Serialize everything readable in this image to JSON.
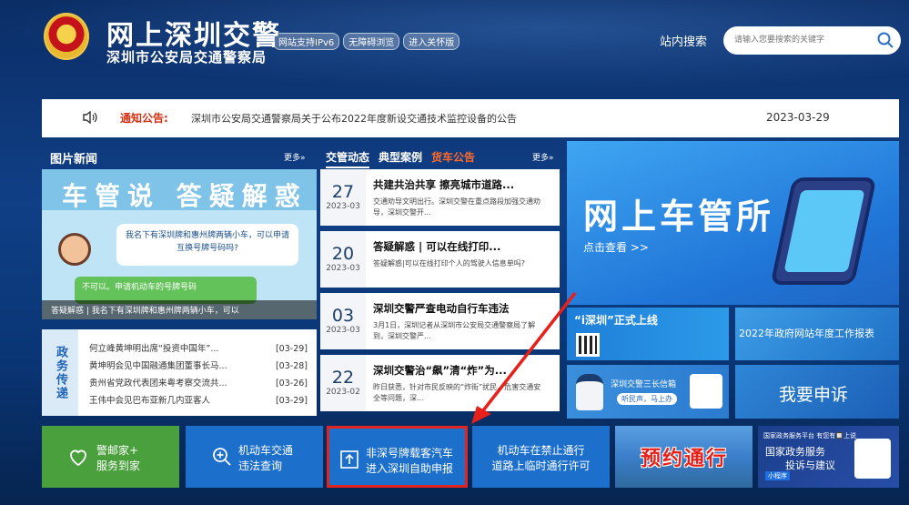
{
  "header": {
    "title": "网上深圳交警",
    "subtitle": "深圳市公安局交通警察局",
    "badges": [
      "网站支持IPv6",
      "无障碍浏览",
      "进入关怀版"
    ],
    "search_label": "站内搜索",
    "search_placeholder": "请输入您要搜索的关键字"
  },
  "notice": {
    "label": "通知公告:",
    "text": "深圳市公安局交通警察局关于公布2022年度新设交通技术监控设备的公告",
    "date": "2023-03-29"
  },
  "photo_news": {
    "title": "图片新闻",
    "more": "更多»",
    "image_heading": "车管说 答疑解惑",
    "bubble_question": "我名下有深圳牌和惠州牌两辆小车，可以申请互换号牌号码吗?",
    "bubble_answer": "不可以。申请机动车的号牌号码",
    "caption": "答疑解惑 | 我名下有深圳牌和惠州牌两辆小车，可以"
  },
  "gov_affairs": {
    "side_label": "政务传递",
    "items": [
      {
        "text": "何立峰黄坤明出席“投资中国年”...",
        "date": "[03-29]"
      },
      {
        "text": "黄坤明会见中国融通集团董事长马...",
        "date": "[03-28]"
      },
      {
        "text": "贵州省党政代表团来粤考察交流共...",
        "date": "[03-26]"
      },
      {
        "text": "王伟中会见巴布亚新几内亚客人",
        "date": "[03-29]"
      }
    ]
  },
  "news": {
    "tabs": [
      "交管动态",
      "典型案例",
      "货车公告"
    ],
    "more": "更多»",
    "items": [
      {
        "day": "27",
        "ym": "2023-03",
        "title": "共建共治共享 擦亮城市道路...",
        "desc": "交通劝导文明出行。深圳交警在重点路段加强交通劝导，深圳交警开..."
      },
      {
        "day": "20",
        "ym": "2023-03",
        "title": "答疑解惑 | 可以在线打印...",
        "desc": "答疑解惑|可以在线打印个人的驾驶人信息单吗?"
      },
      {
        "day": "03",
        "ym": "2023-03",
        "title": "深圳交警严查电动自行车违法",
        "desc": "3月1日，深圳记者从深圳市公安局交通警察局了解到，深圳交警严..."
      },
      {
        "day": "22",
        "ym": "2023-02",
        "title": "深圳交警治“飙”清“炸”为...",
        "desc": "昨日获悉，针对市民反映的“炸街”扰民、危害交通安全等问题，深..."
      }
    ]
  },
  "tiles": {
    "main_title": "网上车管所",
    "main_sub": "点击查看 >>",
    "ishenzhen": "“i深圳”正式上线",
    "report": "2022年政府网站年度工作报表",
    "police_mailbox": "深圳交警三长信箱",
    "police_pill": "听民声，马上办",
    "appeal": "我要申诉"
  },
  "bottom_bar": [
    {
      "line1": "警邮家+",
      "line2": "服务到家"
    },
    {
      "line1": "机动车交通",
      "line2": "违法查询"
    },
    {
      "line1": "非深号牌载客汽车",
      "line2": "进入深圳自助申报"
    },
    {
      "line1": "机动车在禁止通行",
      "line2": "道路上临时通行许可"
    },
    {
      "line1": "预约通行"
    },
    {
      "top": "国家政务服务平台 有您有🔲上说",
      "line1": "国家政务服务",
      "line2": "投诉与建议",
      "tag": "小程序"
    }
  ],
  "colors": {
    "accent_red": "#e02420",
    "brand_blue": "#1d6fcc",
    "green": "#4aa03c",
    "notice_red": "#d53012"
  }
}
